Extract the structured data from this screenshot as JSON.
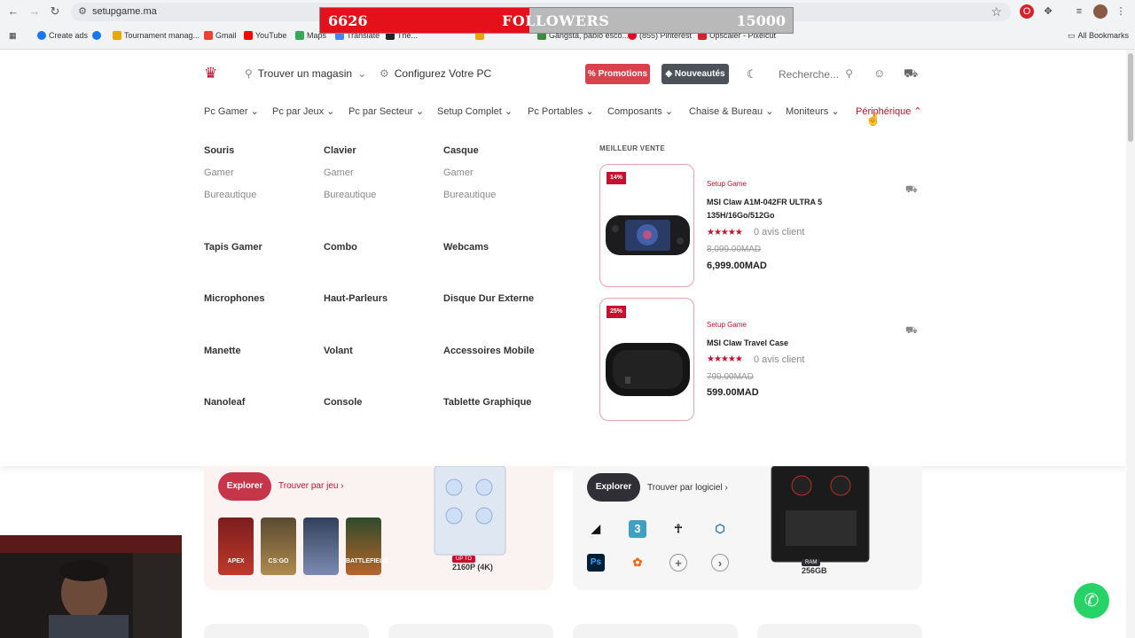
{
  "browser": {
    "url": "setupgame.ma",
    "bookmarks": [
      {
        "label": "Create ads"
      },
      {
        "label": "Tournament manag..."
      },
      {
        "label": "Gmail"
      },
      {
        "label": "YouTube"
      },
      {
        "label": "Maps"
      },
      {
        "label": "Translate"
      },
      {
        "label": "The..."
      },
      {
        "label": "Gangsta, pablo esco..."
      },
      {
        "label": "(855) Pinterest"
      },
      {
        "label": "Upscaler - Pixelcut"
      }
    ],
    "all_bookmarks": "All Bookmarks"
  },
  "overlay": {
    "current": "6626",
    "label": "FOLLOWERS",
    "goal": "15000",
    "progress": 0.442
  },
  "header": {
    "store_link": "Trouver un magasin",
    "config_link": "Configurez Votre PC",
    "promo_btn": "Promotions",
    "new_btn": "Nouveautés",
    "search_placeholder": "Recherche..."
  },
  "nav": [
    {
      "label": "Pc Gamer"
    },
    {
      "label": "Pc par Jeux"
    },
    {
      "label": "Pc par Secteur"
    },
    {
      "label": "Setup Complet"
    },
    {
      "label": "Pc Portables"
    },
    {
      "label": "Composants"
    },
    {
      "label": "Chaise & Bureau"
    },
    {
      "label": "Moniteurs"
    },
    {
      "label": "Périphérique"
    }
  ],
  "mega": {
    "col1": {
      "head": "Souris",
      "sub1": "Gamer",
      "sub2": "Bureautique",
      "items": [
        "Tapis Gamer",
        "Microphones",
        "Manette",
        "Nanoleaf"
      ]
    },
    "col2": {
      "head": "Clavier",
      "sub1": "Gamer",
      "sub2": "Bureautique",
      "items": [
        "Combo",
        "Haut-Parleurs",
        "Volant",
        "Console"
      ]
    },
    "col3": {
      "head": "Casque",
      "sub1": "Gamer",
      "sub2": "Bureautique",
      "items": [
        "Webcams",
        "Disque Dur Externe",
        "Accessoires Mobile",
        "Tablette Graphique"
      ]
    },
    "bestseller_title": "MEILLEUR VENTE",
    "products": [
      {
        "discount": "14%",
        "brand": "Setup Game",
        "name": "MSI Claw A1M-042FR ULTRA 5 135H/16Go/512Go",
        "stars": "★★★★★",
        "reviews": "0 avis client",
        "old_price": "8,099.00MAD",
        "price": "6,999.00MAD"
      },
      {
        "discount": "25%",
        "brand": "Setup Game",
        "name": "MSI Claw Travel Case",
        "stars": "★★★★★",
        "reviews": "0 avis client",
        "old_price": "799.00MAD",
        "price": "599.00MAD"
      }
    ]
  },
  "lower": {
    "left": {
      "explore": "Explorer",
      "find": "Trouver par jeu",
      "games": [
        "APEX",
        "CS:GO",
        "",
        "BATTLEFIELD"
      ],
      "badge_small": "UP TO",
      "spec": "2160P (4K)"
    },
    "right": {
      "explore": "Explorer",
      "find": "Trouver par logiciel",
      "badge_small": "RAM",
      "spec": "256GB"
    }
  },
  "colors": {
    "brand_red": "#c8102e",
    "promo": "#d9414d",
    "new": "#4d5159",
    "whatsapp": "#25d366"
  }
}
